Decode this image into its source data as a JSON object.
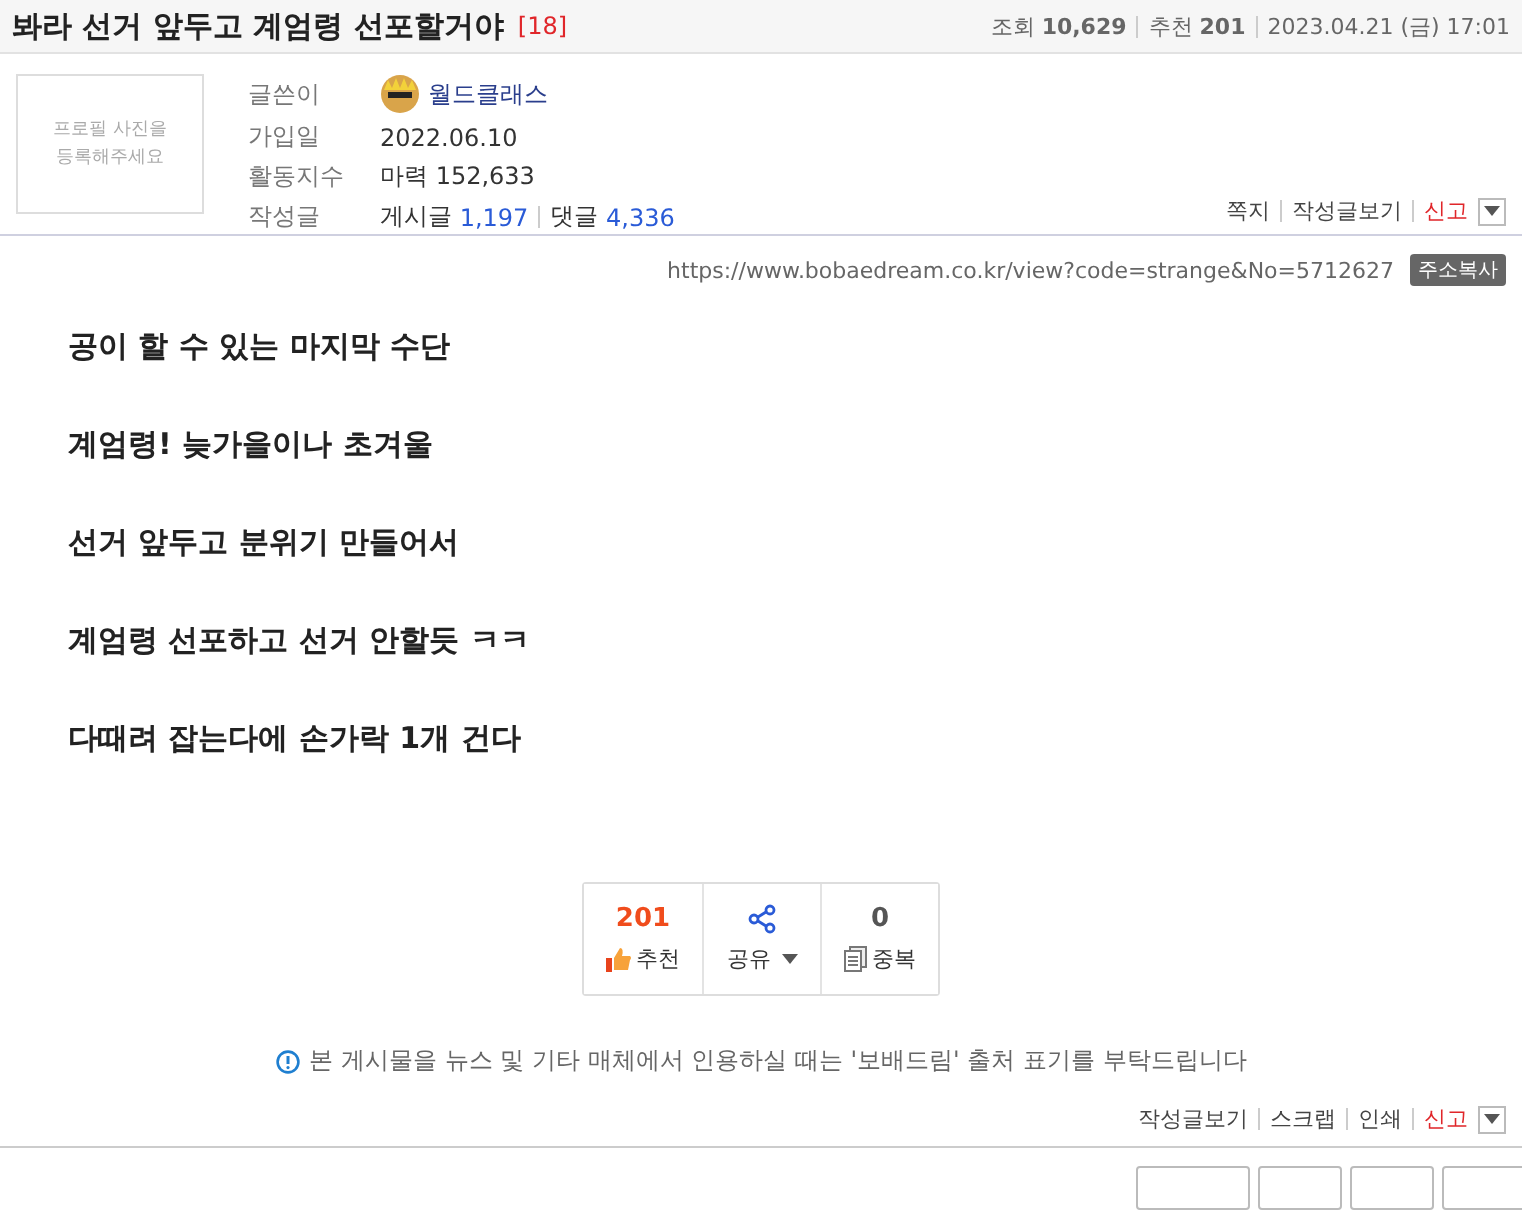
{
  "post": {
    "title": "봐라 선거 앞두고 계엄령 선포할거야",
    "comment_count": "[18]",
    "stats": [
      {
        "label": "조회",
        "value": "10,629"
      },
      {
        "label": "추천",
        "value": "201"
      }
    ],
    "date": "2023.04.21 (금) 17:01"
  },
  "author": {
    "photo_placeholder": "프로필 사진을 등록해주세요",
    "rows": [
      {
        "label": "글쓴이",
        "kind": "nick",
        "value": "월드클래스"
      },
      {
        "label": "가입일",
        "kind": "plain",
        "value": "2022.06.10"
      },
      {
        "label": "활동지수",
        "kind": "plain",
        "value": "마력 152,633"
      },
      {
        "label": "작성글",
        "kind": "counts",
        "posts_label": "게시글",
        "posts": "1,197",
        "comments_label": "댓글",
        "comments": "4,336"
      }
    ],
    "links": [
      {
        "label": "쪽지",
        "warn": false
      },
      {
        "label": "작성글보기",
        "warn": false
      },
      {
        "label": "신고",
        "warn": true
      }
    ]
  },
  "url": "https://www.bobaedream.co.kr/view?code=strange&No=5712627",
  "copy_button": "주소복사",
  "body": [
    "공이 할 수 있는 마지막 수단",
    "계엄령! 늦가을이나 초겨울",
    "선거 앞두고 분위기 만들어서",
    "계엄령 선포하고 선거 안할듯 ㅋㅋ",
    "다때려 잡는다에 손가락 1개 건다"
  ],
  "actions": [
    {
      "kind": "recommend",
      "count": "201",
      "label": "추천"
    },
    {
      "kind": "share",
      "label": "공유"
    },
    {
      "kind": "duplicate",
      "count": "0",
      "label": "중복"
    }
  ],
  "notice": "본 게시물을 뉴스 및 기타 매체에서 인용하실 때는 '보배드림' 출처 표기를 부탁드립니다",
  "bottom_links": [
    {
      "label": "작성글보기",
      "warn": false
    },
    {
      "label": "스크랩",
      "warn": false
    },
    {
      "label": "인쇄",
      "warn": false
    },
    {
      "label": "신고",
      "warn": true
    }
  ]
}
